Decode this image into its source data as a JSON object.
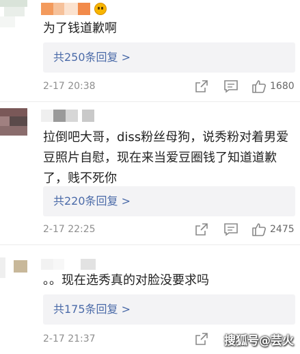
{
  "comments": [
    {
      "text": "为了钱道歉啊",
      "reply_label": "共250条回复 >",
      "time": "2-17 20:38",
      "likes": "1680"
    },
    {
      "text": "拉倒吧大哥，diss粉丝母狗，说秀粉对着男爱豆照片自慰，现在来当爱豆圈钱了知道道歉了，贱不死你",
      "reply_label": "共220条回复 >",
      "time": "2-17 22:25",
      "likes": "2475"
    },
    {
      "text": "。。现在选秀真的对脸没要求吗",
      "reply_label": "共175条回复 >",
      "time": "2-17 21:37",
      "likes": ""
    }
  ],
  "icons": {
    "share": "share-icon",
    "comment": "comment-icon",
    "like": "thumbs-up-icon",
    "emoji": "emoji-icon"
  },
  "watermark": "搜狐号@芸火",
  "colors": {
    "reply_text": "#4a6aa8",
    "reply_bg": "#f3f3f5",
    "time_text": "#8e8e8e",
    "body_text": "#222222"
  }
}
